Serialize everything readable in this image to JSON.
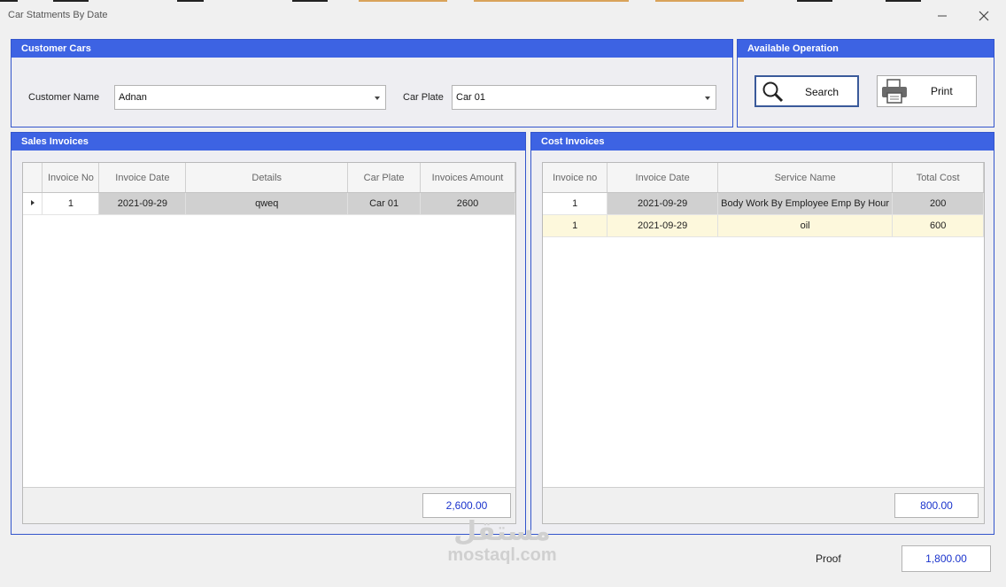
{
  "window": {
    "title": "Car Statments By Date"
  },
  "colors": {
    "group_header": "#3d63e3",
    "total_text": "#1a33cc",
    "selected_row": "#d0d0d0",
    "alt_row": "#fdf8dc"
  },
  "customer_cars": {
    "title": "Customer Cars",
    "customer_name_label": "Customer Name",
    "customer_name_value": "Adnan",
    "car_plate_label": "Car Plate",
    "car_plate_value": "Car 01"
  },
  "operations": {
    "title": "Available Operation",
    "search_label": "Search",
    "print_label": "Print"
  },
  "sales": {
    "title": "Sales Invoices",
    "columns": [
      "Invoice No",
      "Invoice Date",
      "Details",
      "Car Plate",
      "Invoices Amount"
    ],
    "rows": [
      {
        "invoice_no": "1",
        "invoice_date": "2021-09-29",
        "details": "qweq",
        "car_plate": "Car 01",
        "amount": "2600"
      }
    ],
    "total": "2,600.00"
  },
  "cost": {
    "title": "Cost Invoices",
    "columns": [
      "Invoice no",
      "Invoice Date",
      "Service Name",
      "Total Cost"
    ],
    "rows": [
      {
        "invoice_no": "1",
        "invoice_date": "2021-09-29",
        "service_name": "Body Work By Employee Emp By Hour",
        "total_cost": "200"
      },
      {
        "invoice_no": "1",
        "invoice_date": "2021-09-29",
        "service_name": "oil",
        "total_cost": "600"
      }
    ],
    "total": "800.00"
  },
  "proof": {
    "label": "Proof",
    "value": "1,800.00"
  },
  "watermark": {
    "arabic": "مستقل",
    "latin": "mostaql.com"
  }
}
